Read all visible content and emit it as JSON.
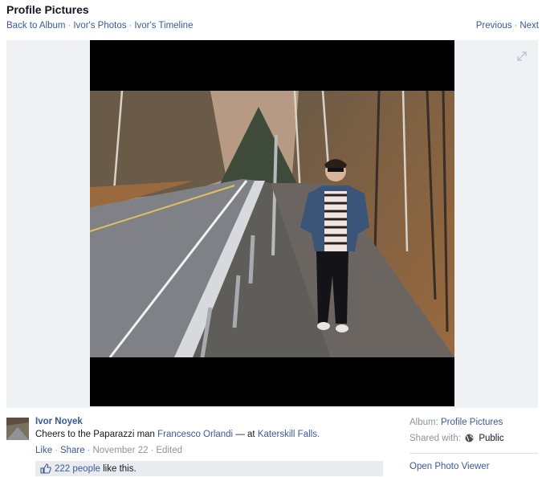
{
  "header": {
    "title": "Profile Pictures",
    "breadcrumbs": [
      "Back to Album",
      "Ivor's Photos",
      "Ivor's Timeline"
    ],
    "separator": "·",
    "nav": {
      "previous": "Previous",
      "next": "Next"
    }
  },
  "photo": {
    "expand_icon": "expand-icon",
    "description_icon": "photo-of-man-on-roadside"
  },
  "post": {
    "owner": "Ivor Noyek",
    "caption_text": "Cheers to the Paparazzi man",
    "tagged_person": "Francesco Orlandi",
    "location_prefix": "— at",
    "location": "Katerskill Falls.",
    "actions": {
      "like": "Like",
      "share": "Share",
      "date": "November 22",
      "edited": "Edited"
    },
    "likes": {
      "count_text": "222 people",
      "suffix": "like this."
    }
  },
  "sidebar": {
    "album_label": "Album:",
    "album_value": "Profile Pictures",
    "shared_label": "Shared with:",
    "shared_value": "Public",
    "open_viewer": "Open Photo Viewer"
  },
  "colors": {
    "link": "#3b5998",
    "muted": "#90949c",
    "stage_bg": "#f0f1f4"
  }
}
